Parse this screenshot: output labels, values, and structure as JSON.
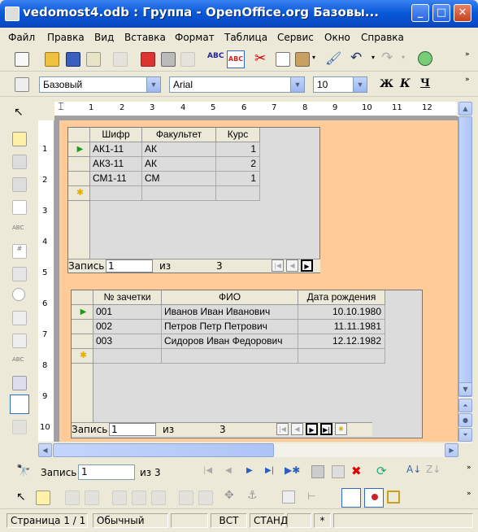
{
  "window": {
    "title": "vedomost4.odb : Группа - OpenOffice.org Базовы..."
  },
  "menu": [
    "Файл",
    "Правка",
    "Вид",
    "Вставка",
    "Формат",
    "Таблица",
    "Сервис",
    "Окно",
    "Справка"
  ],
  "format_bar": {
    "style": "Базовый",
    "font": "Arial",
    "size": "10",
    "bold": "Ж",
    "italic": "К",
    "underline": "Ч"
  },
  "ruler": {
    "h_marks": [
      "1",
      "2",
      "3",
      "4",
      "5",
      "6",
      "7",
      "8",
      "9",
      "10",
      "11",
      "12"
    ],
    "v_marks": [
      "1",
      "2",
      "3",
      "4",
      "5",
      "6",
      "7",
      "8",
      "9",
      "10"
    ]
  },
  "grid1": {
    "columns": [
      "Шифр",
      "Факультет",
      "Курс"
    ],
    "rows": [
      [
        "АК1-11",
        "АК",
        "1"
      ],
      [
        "АК3-11",
        "АК",
        "2"
      ],
      [
        "СМ1-11",
        "СМ",
        "1"
      ]
    ],
    "nav": {
      "record_label": "Запись",
      "record_value": "1",
      "of_label": "из",
      "total": "3"
    }
  },
  "grid2": {
    "columns": [
      "№ зачетки",
      "ФИО",
      "Дата рождения"
    ],
    "rows": [
      [
        "001",
        "Иванов Иван Иванович",
        "10.10.1980"
      ],
      [
        "002",
        "Петров Петр Петрович",
        "11.11.1981"
      ],
      [
        "003",
        "Сидоров Иван Федорович",
        "12.12.1982"
      ]
    ],
    "nav": {
      "record_label": "Запись",
      "record_value": "1",
      "of_label": "из",
      "total": "3"
    }
  },
  "form_nav": {
    "record_label": "Запись",
    "record_value": "1",
    "of_label": "из 3"
  },
  "status": {
    "page": "Страница  1 / 1",
    "style": "Обычный",
    "insert": "ВСТ",
    "select": "СТАНД",
    "modified": "*"
  }
}
